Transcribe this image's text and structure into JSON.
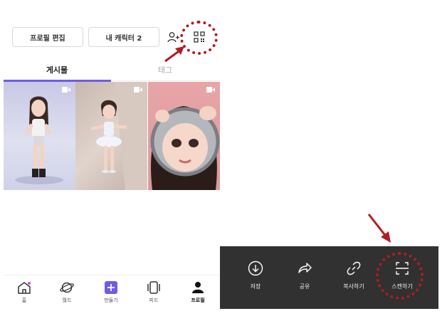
{
  "profile_actions": {
    "edit_label": "프로필 편집",
    "character_label": "내 캐릭터 2"
  },
  "tabs": [
    {
      "label": "게시물",
      "active": true
    },
    {
      "label": "태그",
      "active": false
    }
  ],
  "bottom_nav": [
    {
      "label": "홈",
      "icon": "home-icon"
    },
    {
      "label": "월드",
      "icon": "planet-icon"
    },
    {
      "label": "만들기",
      "icon": "plus-icon"
    },
    {
      "label": "피드",
      "icon": "feed-icon"
    },
    {
      "label": "프로필",
      "icon": "profile-icon",
      "active": true
    }
  ],
  "share_sheet": [
    {
      "label": "저장",
      "icon": "download-icon"
    },
    {
      "label": "공유",
      "icon": "share-icon"
    },
    {
      "label": "복사하기",
      "icon": "link-icon"
    },
    {
      "label": "스캔하기",
      "icon": "scan-icon"
    }
  ],
  "colors": {
    "accent": "#6f5ce6",
    "annotation": "#b11c22",
    "sheet_bg": "#313131"
  }
}
